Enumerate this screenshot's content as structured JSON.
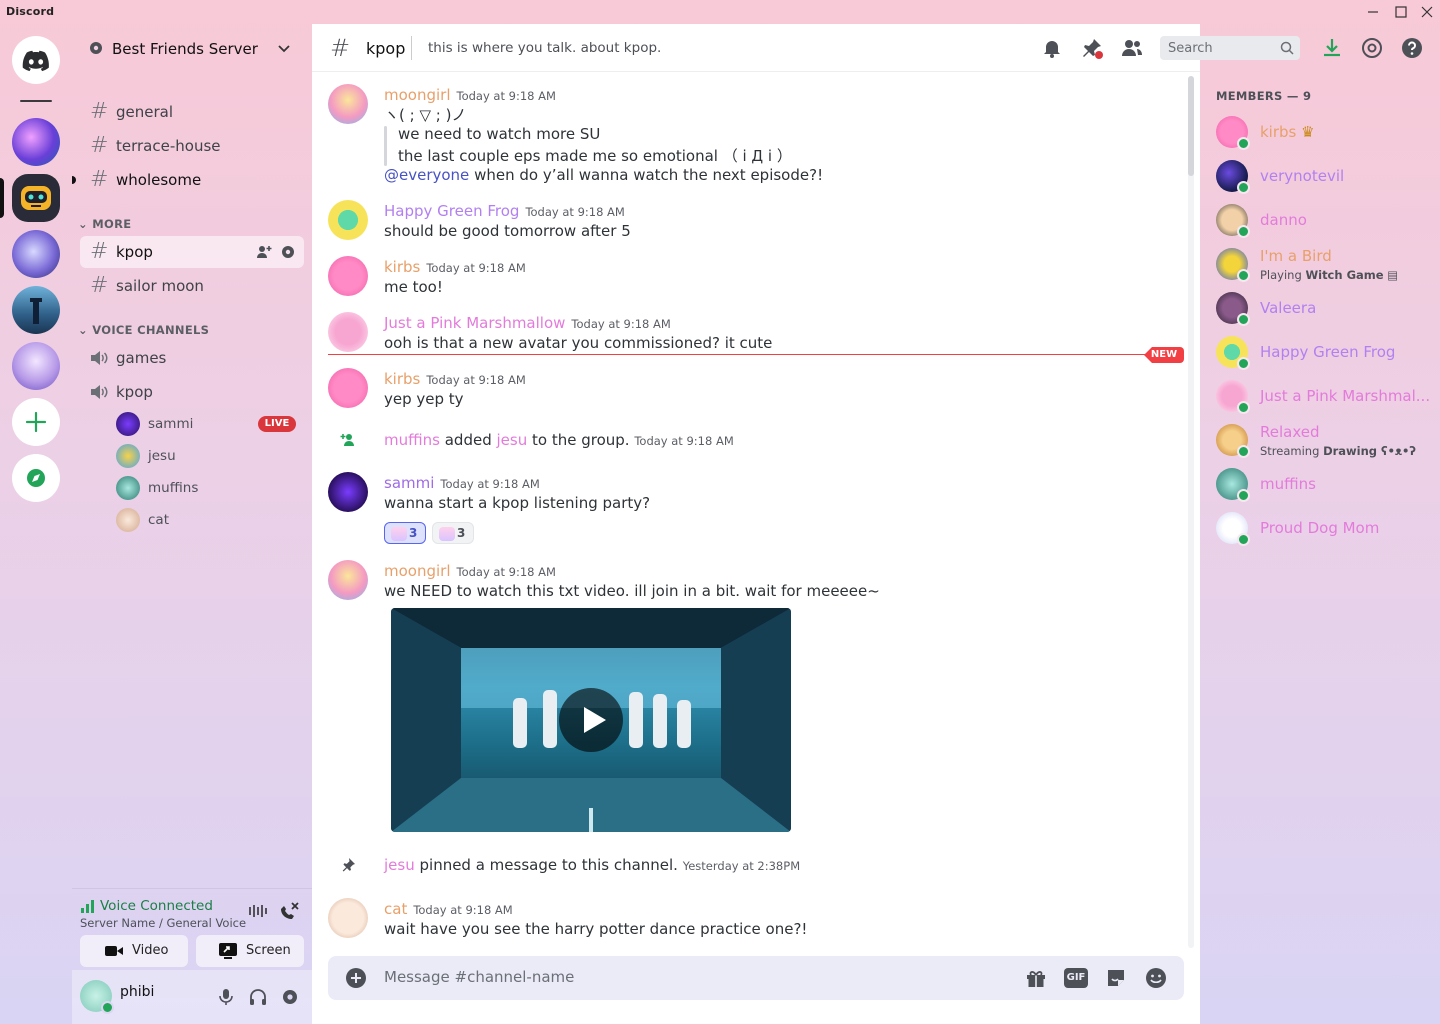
{
  "app": {
    "title": "Discord"
  },
  "colors": {
    "accent": "#5865f2",
    "online": "#23a559",
    "live": "#da373c",
    "new": "#f23f43",
    "name_orange": "#e8a06a",
    "name_pink": "#e37bdb",
    "name_purple": "#b280f0",
    "name_purple_alt": "#a06be6"
  },
  "servers": [
    "discord-home",
    "server-1",
    "server-2",
    "server-3",
    "server-4",
    "server-5",
    "add-server",
    "explore"
  ],
  "server": {
    "name": "Best Friends Server"
  },
  "channels": {
    "text": [
      {
        "name": "general"
      },
      {
        "name": "terrace-house"
      },
      {
        "name": "wholesome"
      }
    ],
    "more_label": "MORE",
    "more": [
      {
        "name": "kpop"
      },
      {
        "name": "sailor moon"
      }
    ],
    "voice_label": "VOICE CHANNELS",
    "voice": [
      {
        "name": "games"
      },
      {
        "name": "kpop"
      }
    ],
    "voice_users": [
      {
        "name": "sammi",
        "live": "LIVE"
      },
      {
        "name": "jesu"
      },
      {
        "name": "muffins"
      },
      {
        "name": "cat"
      }
    ]
  },
  "voice_panel": {
    "status": "Voice Connected",
    "location": "Server Name / General Voice",
    "video_label": "Video",
    "screen_label": "Screen"
  },
  "user_panel": {
    "name": "phibi"
  },
  "header": {
    "channel": "kpop",
    "topic": "this is where you talk. about kpop.",
    "search_placeholder": "Search"
  },
  "messages": [
    {
      "author": "moongirl",
      "time": "Today at 9:18 AM",
      "lines": [
        "ヽ( ; ▽ ; )ノ",
        "we need to watch more SU",
        "the last couple eps made me so emotional （ i Д i ）"
      ],
      "mention": "@everyone",
      "mention_text": "when do y’all wanna watch the next episode?!"
    },
    {
      "author": "Happy Green Frog",
      "time": "Today at 9:18 AM",
      "text": "should be good tomorrow after 5"
    },
    {
      "author": "kirbs",
      "time": "Today at 9:18 AM",
      "text": "me too!"
    },
    {
      "author": "Just a Pink Marshmallow",
      "time": "Today at 9:18 AM",
      "text": "ooh is that a new avatar you commissioned? it cute"
    },
    {
      "author": "kirbs",
      "time": "Today at 9:18 AM",
      "text": "yep yep ty"
    },
    {
      "author": "sammi",
      "time": "Today at 9:18 AM",
      "text": "wanna start a kpop listening party?",
      "reactions": [
        {
          "count": "3"
        },
        {
          "count": "3"
        }
      ]
    },
    {
      "author": "moongirl",
      "time": "Today at 9:18 AM",
      "text": "we NEED to watch this txt video. ill join in a bit. wait for meeeee~"
    },
    {
      "author": "cat",
      "time": "Today at 9:18 AM",
      "text": "wait have you see the harry potter dance practice one?!"
    }
  ],
  "system": {
    "added": {
      "actor": "muffins",
      "verb": "added",
      "target": "jesu",
      "rest": "to the group.",
      "time": "Today at 9:18 AM"
    },
    "pinned": {
      "actor": "jesu",
      "rest": "pinned a message to this channel.",
      "time": "Yesterday at 2:38PM"
    }
  },
  "new_badge": "NEW",
  "composer": {
    "placeholder": "Message #channel-name",
    "gif": "GIF"
  },
  "members": {
    "title": "MEMBERS — 9",
    "list": [
      {
        "name": "kirbs",
        "owner": true
      },
      {
        "name": "verynotevil"
      },
      {
        "name": "danno"
      },
      {
        "name": "I'm a Bird",
        "activity_prefix": "Playing",
        "activity": "Witch Game"
      },
      {
        "name": "Valeera"
      },
      {
        "name": "Happy Green Frog"
      },
      {
        "name": "Just a Pink Marshmal..."
      },
      {
        "name": "Relaxed",
        "activity_prefix": "Streaming",
        "activity": "Drawing ʕ•ᴥ•ʔ"
      },
      {
        "name": "muffins"
      },
      {
        "name": "Proud Dog Mom"
      }
    ]
  }
}
